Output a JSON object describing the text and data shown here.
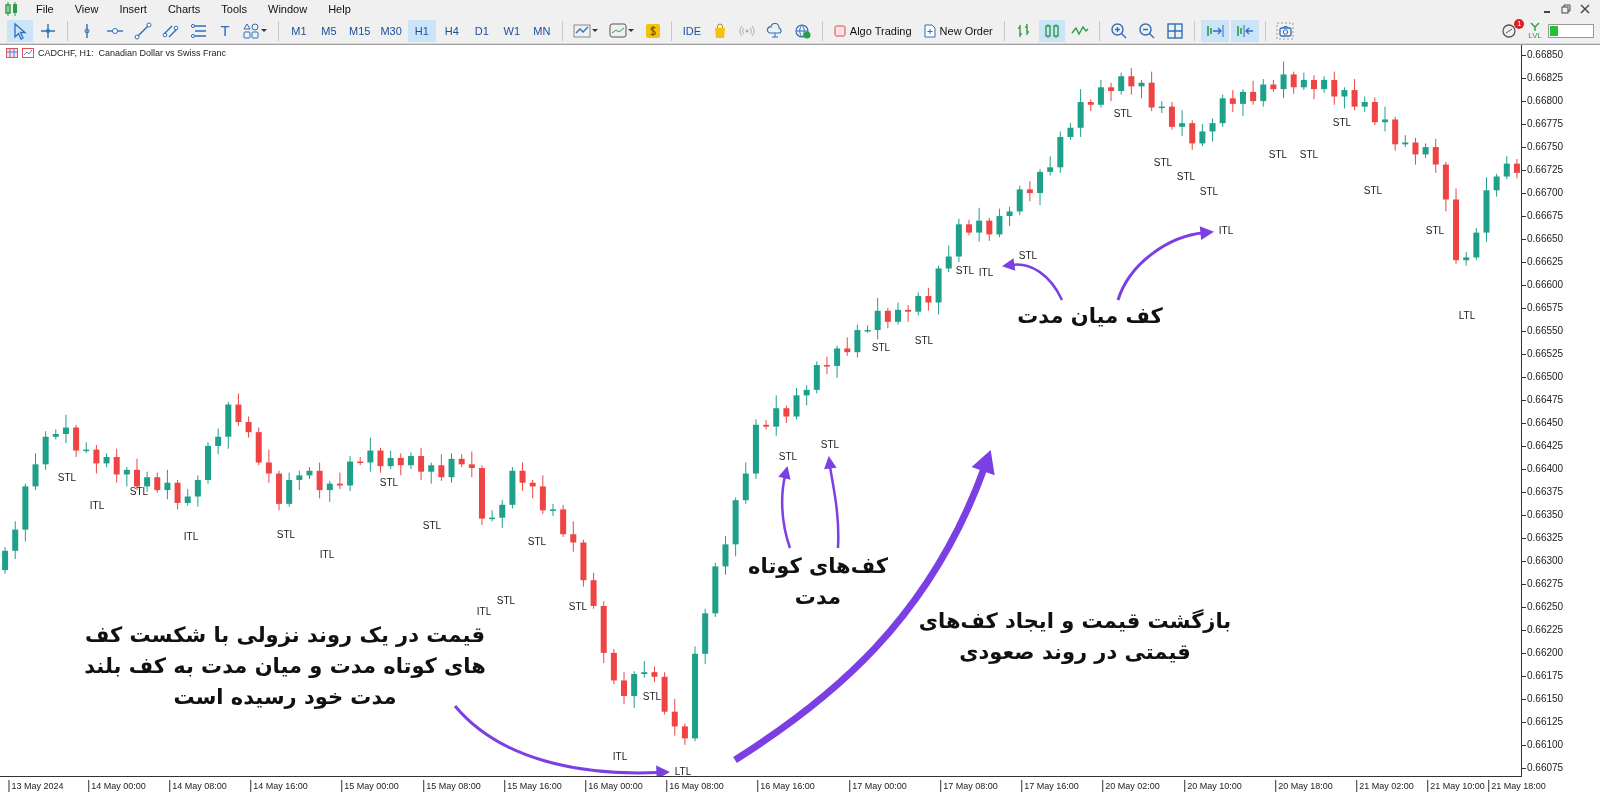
{
  "menu": [
    {
      "label": "File"
    },
    {
      "label": "View"
    },
    {
      "label": "Insert"
    },
    {
      "label": "Charts"
    },
    {
      "label": "Tools"
    },
    {
      "label": "Window"
    },
    {
      "label": "Help"
    }
  ],
  "toolbar": {
    "drawing_tools": [
      {
        "kind": "cursor",
        "selected": true
      },
      {
        "kind": "crosshair",
        "selected": false
      },
      {
        "kind": "vline",
        "selected": false
      },
      {
        "kind": "hline",
        "selected": false
      },
      {
        "kind": "trend",
        "selected": false
      },
      {
        "kind": "channel",
        "selected": false
      },
      {
        "kind": "fibo",
        "selected": false
      },
      {
        "kind": "text",
        "label": "T",
        "selected": false
      },
      {
        "kind": "shapes",
        "selected": false
      }
    ],
    "timeframes": [
      {
        "label": "M1",
        "selected": false
      },
      {
        "label": "M5",
        "selected": false
      },
      {
        "label": "M15",
        "selected": false
      },
      {
        "label": "M30",
        "selected": false
      },
      {
        "label": "H1",
        "selected": true
      },
      {
        "label": "H4",
        "selected": false
      },
      {
        "label": "D1",
        "selected": false
      },
      {
        "label": "W1",
        "selected": false
      },
      {
        "label": "MN",
        "selected": false
      }
    ],
    "ide": "IDE",
    "algo_trading": "Algo Trading",
    "new_order": "New Order",
    "chart_types": [
      {
        "kind": "bars",
        "selected": false
      },
      {
        "kind": "candles",
        "selected": true
      },
      {
        "kind": "line",
        "selected": false
      }
    ],
    "auto_scroll": {
      "on": true
    },
    "chart_shift": {
      "on": true
    },
    "notification_badge": "1",
    "lvl_label": "LVL"
  },
  "chart": {
    "title": "CADCHF, H1:  Canadian Dollar vs Swiss Franc",
    "chart_data": {
      "type": "candlestick",
      "categories": [
        null,
        null,
        null,
        "13 May 2024",
        null,
        null,
        null,
        null,
        null,
        null,
        null,
        "14 May 00:00",
        null,
        null,
        null,
        null,
        null,
        null,
        null,
        "14 May 08:00",
        null,
        null,
        null,
        null,
        null,
        null,
        null,
        "14 May 16:00",
        null,
        null,
        null,
        null,
        null,
        null,
        null,
        null,
        "15 May 00:00",
        null,
        null,
        null,
        null,
        null,
        null,
        null,
        "15 May 08:00",
        null,
        null,
        null,
        null,
        null,
        null,
        null,
        "15 May 16:00",
        null,
        null,
        null,
        null,
        null,
        null,
        null,
        "16 May 00:00",
        null,
        null,
        null,
        null,
        null,
        null,
        null,
        "16 May 08:00",
        null,
        null,
        null,
        null,
        null,
        null,
        null,
        null,
        "16 May 16:00",
        null,
        null,
        null,
        null,
        null,
        null,
        null,
        null,
        "17 May 00:00",
        null,
        null,
        null,
        null,
        null,
        null,
        null,
        null,
        "17 May 08:00",
        null,
        null,
        null,
        null,
        null,
        null,
        null,
        "17 May 16:00",
        null,
        null,
        null,
        null,
        null,
        null,
        null,
        "20 May 02:00",
        null,
        null,
        null,
        null,
        null,
        null,
        null,
        "20 May 10:00",
        null,
        null,
        null,
        null,
        null,
        null,
        null,
        null,
        "20 May 18:00",
        null,
        null,
        null,
        null,
        null,
        null,
        null,
        "21 May 02:00",
        null,
        null,
        null,
        null,
        null,
        null,
        "21 May 10:00",
        null,
        null,
        null,
        null,
        null,
        "21 May 18:00"
      ],
      "ohlc": [
        [
          0.6629,
          0.66315,
          0.66286,
          0.66311
        ],
        [
          0.66311,
          0.66343,
          0.66302,
          0.66334
        ],
        [
          0.66334,
          0.66384,
          0.66321,
          0.66381
        ],
        [
          0.66381,
          0.66417,
          0.66377,
          0.66405
        ],
        [
          0.66405,
          0.66441,
          0.66399,
          0.66435
        ],
        [
          0.66435,
          0.66443,
          0.66432,
          0.66438
        ],
        [
          0.66438,
          0.66459,
          0.66428,
          0.66445
        ],
        [
          0.66445,
          0.66448,
          0.66413,
          0.6642
        ],
        [
          0.6642,
          0.66429,
          0.66417,
          0.66421
        ],
        [
          0.66421,
          0.66426,
          0.66395,
          0.66406
        ],
        [
          0.66406,
          0.66417,
          0.66402,
          0.66413
        ],
        [
          0.66413,
          0.66422,
          0.66385,
          0.66394
        ],
        [
          0.66394,
          0.66402,
          0.66381,
          0.66399
        ],
        [
          0.66399,
          0.66411,
          0.66377,
          0.66381
        ],
        [
          0.66381,
          0.66397,
          0.66375,
          0.66391
        ],
        [
          0.66391,
          0.66396,
          0.66374,
          0.66377
        ],
        [
          0.66377,
          0.66399,
          0.66367,
          0.66385
        ],
        [
          0.66385,
          0.66388,
          0.66356,
          0.66363
        ],
        [
          0.66363,
          0.66378,
          0.6636,
          0.6637
        ],
        [
          0.6637,
          0.66393,
          0.66359,
          0.66388
        ],
        [
          0.66388,
          0.66429,
          0.66384,
          0.66425
        ],
        [
          0.66425,
          0.66444,
          0.66416,
          0.66435
        ],
        [
          0.66435,
          0.66473,
          0.66422,
          0.6647
        ],
        [
          0.6647,
          0.66482,
          0.66447,
          0.66451
        ],
        [
          0.66451,
          0.66457,
          0.66434,
          0.6644
        ],
        [
          0.6644,
          0.66445,
          0.66404,
          0.66407
        ],
        [
          0.66407,
          0.66421,
          0.66385,
          0.66395
        ],
        [
          0.66395,
          0.66398,
          0.66355,
          0.66362
        ],
        [
          0.66362,
          0.66396,
          0.66359,
          0.66388
        ],
        [
          0.66388,
          0.66398,
          0.66377,
          0.66393
        ],
        [
          0.66393,
          0.66402,
          0.66389,
          0.66398
        ],
        [
          0.66398,
          0.66407,
          0.66368,
          0.66377
        ],
        [
          0.66377,
          0.66387,
          0.66364,
          0.66384
        ],
        [
          0.66384,
          0.66396,
          0.66378,
          0.66382
        ],
        [
          0.66382,
          0.66414,
          0.66376,
          0.66408
        ],
        [
          0.66408,
          0.66413,
          0.66404,
          0.66407
        ],
        [
          0.66407,
          0.66434,
          0.66397,
          0.6642
        ],
        [
          0.6642,
          0.66423,
          0.66396,
          0.66403
        ],
        [
          0.66403,
          0.6642,
          0.664,
          0.66412
        ],
        [
          0.66412,
          0.66417,
          0.66393,
          0.66404
        ],
        [
          0.66404,
          0.66418,
          0.664,
          0.66414
        ],
        [
          0.66414,
          0.66423,
          0.66388,
          0.66397
        ],
        [
          0.66397,
          0.66407,
          0.66384,
          0.66404
        ],
        [
          0.66404,
          0.66416,
          0.66387,
          0.66391
        ],
        [
          0.66391,
          0.66417,
          0.66385,
          0.66411
        ],
        [
          0.66411,
          0.66416,
          0.66402,
          0.66405
        ],
        [
          0.66405,
          0.66419,
          0.66391,
          0.66401
        ],
        [
          0.66401,
          0.66404,
          0.66339,
          0.66346
        ],
        [
          0.66346,
          0.66355,
          0.66343,
          0.66347
        ],
        [
          0.66347,
          0.66366,
          0.66336,
          0.66361
        ],
        [
          0.66361,
          0.66402,
          0.66357,
          0.66398
        ],
        [
          0.66398,
          0.66407,
          0.66376,
          0.66385
        ],
        [
          0.66385,
          0.66388,
          0.66368,
          0.66381
        ],
        [
          0.66381,
          0.66393,
          0.66351,
          0.66355
        ],
        [
          0.66355,
          0.66362,
          0.66349,
          0.66356
        ],
        [
          0.66356,
          0.66361,
          0.66326,
          0.66329
        ],
        [
          0.66329,
          0.66343,
          0.6631,
          0.6632
        ],
        [
          0.6632,
          0.66323,
          0.66272,
          0.66279
        ],
        [
          0.66279,
          0.66287,
          0.66248,
          0.66251
        ],
        [
          0.66251,
          0.66256,
          0.66189,
          0.662
        ],
        [
          0.662,
          0.66204,
          0.66166,
          0.6617
        ],
        [
          0.6617,
          0.66179,
          0.66144,
          0.66153
        ],
        [
          0.66153,
          0.6618,
          0.6614,
          0.66177
        ],
        [
          0.66177,
          0.66191,
          0.66173,
          0.66179
        ],
        [
          0.66179,
          0.66185,
          0.66168,
          0.66174
        ],
        [
          0.66174,
          0.66179,
          0.66133,
          0.66136
        ],
        [
          0.66136,
          0.6615,
          0.6611,
          0.6612
        ],
        [
          0.6612,
          0.66123,
          0.661,
          0.66107
        ],
        [
          0.66107,
          0.66207,
          0.66104,
          0.66199
        ],
        [
          0.66199,
          0.66248,
          0.66188,
          0.66243
        ],
        [
          0.66243,
          0.66298,
          0.66239,
          0.66294
        ],
        [
          0.66294,
          0.66327,
          0.66285,
          0.66318
        ],
        [
          0.66318,
          0.66369,
          0.66305,
          0.66366
        ],
        [
          0.66366,
          0.66407,
          0.66362,
          0.66395
        ],
        [
          0.66395,
          0.66454,
          0.66389,
          0.66448
        ],
        [
          0.66448,
          0.66453,
          0.66443,
          0.66446
        ],
        [
          0.66446,
          0.6648,
          0.66436,
          0.66466
        ],
        [
          0.66466,
          0.66469,
          0.6645,
          0.66457
        ],
        [
          0.66457,
          0.66488,
          0.66454,
          0.6648
        ],
        [
          0.6648,
          0.66491,
          0.66469,
          0.66486
        ],
        [
          0.66486,
          0.66517,
          0.66482,
          0.66513
        ],
        [
          0.66513,
          0.66522,
          0.66503,
          0.66512
        ],
        [
          0.66512,
          0.66534,
          0.66499,
          0.66531
        ],
        [
          0.66531,
          0.66543,
          0.66523,
          0.66527
        ],
        [
          0.66527,
          0.66557,
          0.66521,
          0.66551
        ],
        [
          0.66551,
          0.66556,
          0.66548,
          0.66551
        ],
        [
          0.66551,
          0.66586,
          0.66541,
          0.66572
        ],
        [
          0.66572,
          0.66575,
          0.66553,
          0.6656
        ],
        [
          0.6656,
          0.66581,
          0.66557,
          0.66573
        ],
        [
          0.66573,
          0.66578,
          0.6656,
          0.66571
        ],
        [
          0.66571,
          0.66592,
          0.66567,
          0.66588
        ],
        [
          0.66588,
          0.66597,
          0.66572,
          0.66581
        ],
        [
          0.66581,
          0.66621,
          0.66568,
          0.66618
        ],
        [
          0.66618,
          0.66643,
          0.66614,
          0.66631
        ],
        [
          0.66631,
          0.66672,
          0.66625,
          0.66666
        ],
        [
          0.66666,
          0.66671,
          0.66654,
          0.66657
        ],
        [
          0.66657,
          0.66684,
          0.66647,
          0.6667
        ],
        [
          0.6667,
          0.66673,
          0.66648,
          0.66655
        ],
        [
          0.66655,
          0.66683,
          0.66652,
          0.66675
        ],
        [
          0.66675,
          0.66685,
          0.66664,
          0.6668
        ],
        [
          0.6668,
          0.66708,
          0.66676,
          0.66704
        ],
        [
          0.66704,
          0.66713,
          0.66691,
          0.667
        ],
        [
          0.667,
          0.66726,
          0.66687,
          0.66723
        ],
        [
          0.66723,
          0.6674,
          0.66719,
          0.66728
        ],
        [
          0.66728,
          0.66767,
          0.66722,
          0.66761
        ],
        [
          0.66761,
          0.66776,
          0.66758,
          0.66771
        ],
        [
          0.66771,
          0.66813,
          0.66761,
          0.66799
        ],
        [
          0.66799,
          0.66802,
          0.66789,
          0.66796
        ],
        [
          0.66796,
          0.66823,
          0.66793,
          0.66815
        ],
        [
          0.66815,
          0.6682,
          0.668,
          0.66811
        ],
        [
          0.66811,
          0.66831,
          0.66807,
          0.66827
        ],
        [
          0.66827,
          0.66836,
          0.66807,
          0.66816
        ],
        [
          0.66816,
          0.66823,
          0.66803,
          0.6682
        ],
        [
          0.6682,
          0.66832,
          0.66789,
          0.66793
        ],
        [
          0.66793,
          0.668,
          0.66787,
          0.66794
        ],
        [
          0.66794,
          0.66799,
          0.66769,
          0.66772
        ],
        [
          0.66772,
          0.6679,
          0.66762,
          0.66776
        ],
        [
          0.66776,
          0.66779,
          0.66747,
          0.66754
        ],
        [
          0.66754,
          0.66775,
          0.66751,
          0.66767
        ],
        [
          0.66767,
          0.66781,
          0.66756,
          0.66776
        ],
        [
          0.66776,
          0.66807,
          0.66772,
          0.66803
        ],
        [
          0.66803,
          0.66812,
          0.66788,
          0.66797
        ],
        [
          0.66797,
          0.66813,
          0.66784,
          0.6681
        ],
        [
          0.6681,
          0.66822,
          0.66796,
          0.668
        ],
        [
          0.668,
          0.66824,
          0.66794,
          0.66818
        ],
        [
          0.66818,
          0.66823,
          0.6681,
          0.66813
        ],
        [
          0.66813,
          0.66843,
          0.66803,
          0.66829
        ],
        [
          0.66829,
          0.66832,
          0.66808,
          0.66815
        ],
        [
          0.66815,
          0.66831,
          0.66812,
          0.66823
        ],
        [
          0.66823,
          0.66828,
          0.66802,
          0.66813
        ],
        [
          0.66813,
          0.66827,
          0.66809,
          0.66823
        ],
        [
          0.66823,
          0.66832,
          0.66796,
          0.66805
        ],
        [
          0.66805,
          0.66815,
          0.66792,
          0.66812
        ],
        [
          0.66812,
          0.66824,
          0.6679,
          0.66794
        ],
        [
          0.66794,
          0.66805,
          0.66788,
          0.66799
        ],
        [
          0.66799,
          0.66804,
          0.66774,
          0.66777
        ],
        [
          0.66777,
          0.66794,
          0.66767,
          0.6678
        ],
        [
          0.6678,
          0.66783,
          0.66746,
          0.66753
        ],
        [
          0.66753,
          0.66763,
          0.6675,
          0.66755
        ],
        [
          0.66755,
          0.6676,
          0.66731,
          0.66742
        ],
        [
          0.66742,
          0.66754,
          0.66738,
          0.6675
        ],
        [
          0.6675,
          0.66759,
          0.66722,
          0.66731
        ],
        [
          0.66731,
          0.66734,
          0.6668,
          0.66693
        ],
        [
          0.66693,
          0.66705,
          0.66623,
          0.66627
        ],
        [
          0.66627,
          0.66636,
          0.66621,
          0.6663
        ],
        [
          0.6663,
          0.66662,
          0.66627,
          0.66657
        ],
        [
          0.66657,
          0.66717,
          0.66647,
          0.66703
        ],
        [
          0.66703,
          0.66721,
          0.66696,
          0.66718
        ],
        [
          0.66718,
          0.6674,
          0.66715,
          0.66732
        ],
        [
          0.66732,
          0.66737,
          0.66716,
          0.66722
        ]
      ],
      "ylim": [
        0.66065,
        0.66861
      ],
      "yticks": [
        {
          "value": 0.6685,
          "label": "0.66850"
        },
        {
          "value": 0.66825,
          "label": "0.66825"
        },
        {
          "value": 0.668,
          "label": "0.66800"
        },
        {
          "value": 0.66775,
          "label": "0.66775"
        },
        {
          "value": 0.6675,
          "label": "0.66750"
        },
        {
          "value": 0.66725,
          "label": "0.66725"
        },
        {
          "value": 0.667,
          "label": "0.66700"
        },
        {
          "value": 0.66675,
          "label": "0.66675"
        },
        {
          "value": 0.6665,
          "label": "0.66650"
        },
        {
          "value": 0.66625,
          "label": "0.66625"
        },
        {
          "value": 0.666,
          "label": "0.66600"
        },
        {
          "value": 0.66575,
          "label": "0.66575"
        },
        {
          "value": 0.6655,
          "label": "0.66550"
        },
        {
          "value": 0.66525,
          "label": "0.66525"
        },
        {
          "value": 0.665,
          "label": "0.66500"
        },
        {
          "value": 0.66475,
          "label": "0.66475"
        },
        {
          "value": 0.6645,
          "label": "0.66450"
        },
        {
          "value": 0.66425,
          "label": "0.66425"
        },
        {
          "value": 0.664,
          "label": "0.66400"
        },
        {
          "value": 0.66375,
          "label": "0.66375"
        },
        {
          "value": 0.6635,
          "label": "0.66350"
        },
        {
          "value": 0.66325,
          "label": "0.66325"
        },
        {
          "value": 0.663,
          "label": "0.66300"
        },
        {
          "value": 0.66275,
          "label": "0.66275"
        },
        {
          "value": 0.6625,
          "label": "0.66250"
        },
        {
          "value": 0.66225,
          "label": "0.66225"
        },
        {
          "value": 0.662,
          "label": "0.66200"
        },
        {
          "value": 0.66175,
          "label": "0.66175"
        },
        {
          "value": 0.6615,
          "label": "0.66150"
        },
        {
          "value": 0.66125,
          "label": "0.66125"
        },
        {
          "value": 0.661,
          "label": "0.66100"
        },
        {
          "value": 0.66075,
          "label": "0.66075"
        }
      ]
    },
    "swing_labels": [
      "STL",
      "ITL",
      "STL",
      "ITL",
      "STL",
      "ITL",
      "STL",
      "STL",
      "ITL",
      "STL",
      "STL",
      "STL",
      "STL",
      "ITL",
      "LTL",
      "STL",
      "STL",
      "STL",
      "STL",
      "STL",
      "ITL",
      "STL",
      "STL",
      "STL",
      "STL",
      "STL",
      "ITL",
      "STL",
      "STL",
      "STL",
      "STL",
      "STL",
      "LTL"
    ],
    "annotations": [
      {
        "text": "کف میان مدت"
      },
      {
        "text": "کف‌های کوتاه\nمدت"
      },
      {
        "text": "بازگشت قیمت و ایجاد کف‌های\nقیمتی در روند صعودی"
      },
      {
        "text": "قیمت در یک روند نزولی با شکست کف\nهای کوتاه مدت و میان مدت به کف بلند\nمدت خود رسیده است"
      }
    ]
  }
}
